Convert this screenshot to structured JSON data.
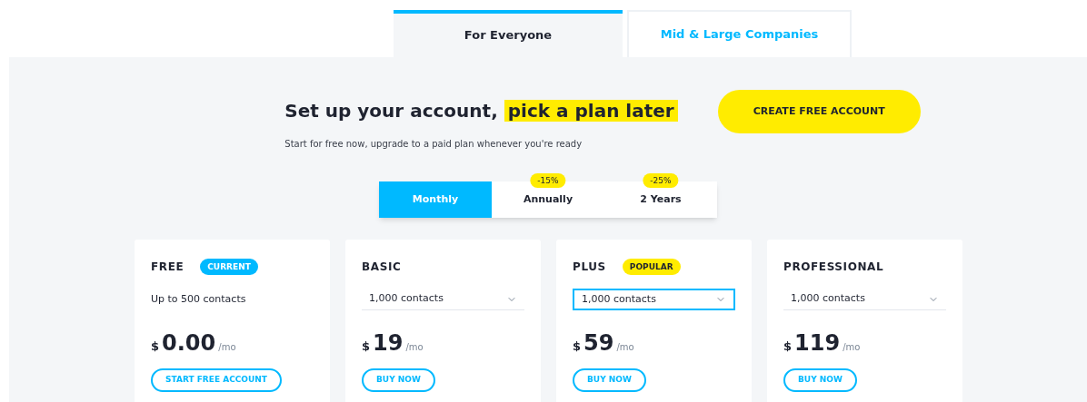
{
  "audience_tabs": [
    {
      "label": "For Everyone",
      "selected": true
    },
    {
      "label": "Mid & Large Companies",
      "selected": false
    }
  ],
  "hero": {
    "title": "Set up your account, **pick a plan later**",
    "subtitle": "Start for free now, upgrade to a paid plan whenever you're ready",
    "button": "CREATE FREE ACCOUNT"
  },
  "billing_tabs": [
    {
      "label": "Monthly",
      "selected": true
    },
    {
      "label": "Annually",
      "selected": false,
      "badge": "-15%"
    },
    {
      "label": "2 Years",
      "selected": false,
      "badge": "-25%"
    }
  ],
  "plans": [
    {
      "name": "FREE",
      "badge": {
        "text": "CURRENT",
        "color": "#00b9ff"
      },
      "kind": "text",
      "detail": "Up to 500 contacts",
      "currency": "$",
      "price": "0.00",
      "period": "/mo",
      "button": "START FREE ACCOUNT"
    },
    {
      "name": "BASIC",
      "kind": "select",
      "detail": "1,000 contacts",
      "currency": "$",
      "price": "19",
      "period": "/mo",
      "button": "BUY NOW",
      "focused": false
    },
    {
      "name": "PLUS",
      "badge": {
        "text": "POPULAR",
        "color": "#ffec00"
      },
      "kind": "select",
      "detail": "1,000 contacts",
      "currency": "$",
      "price": "59",
      "period": "/mo",
      "button": "BUY NOW",
      "focused": true
    },
    {
      "name": "PROFESSIONAL",
      "kind": "select",
      "detail": "1,000 contacts",
      "currency": "$",
      "price": "119",
      "period": "/mo",
      "button": "BUY NOW",
      "focused": false
    }
  ]
}
